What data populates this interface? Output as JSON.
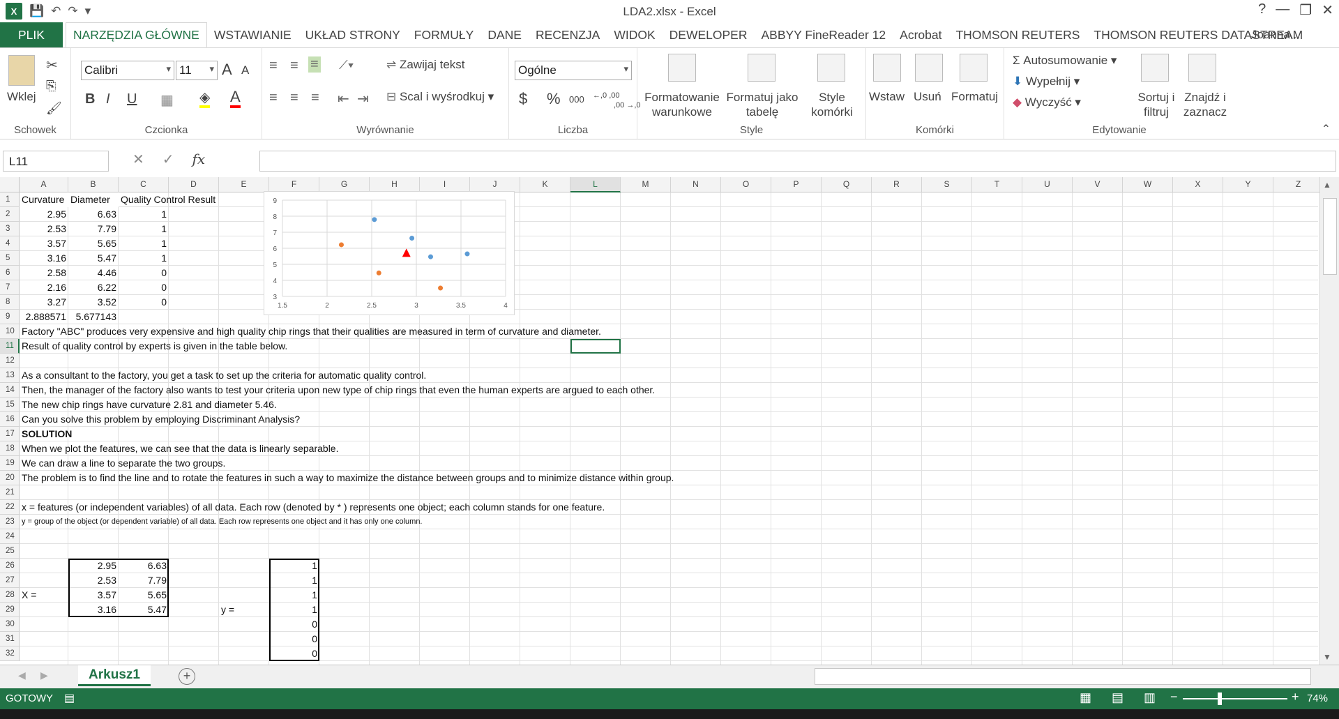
{
  "window": {
    "title": "LDA2.xlsx - Excel",
    "help": "?",
    "user": "Joanna...",
    "minimize": "—",
    "restore": "❐",
    "close": "✕"
  },
  "qat": {
    "save": "💾",
    "undo": "↶",
    "redo": "↷",
    "customize": "▾"
  },
  "tabs": [
    "PLIK",
    "NARZĘDZIA GŁÓWNE",
    "WSTAWIANIE",
    "UKŁAD STRONY",
    "FORMUŁY",
    "DANE",
    "RECENZJA",
    "WIDOK",
    "DEWELOPER",
    "ABBYY FineReader 12",
    "Acrobat",
    "THOMSON REUTERS",
    "THOMSON REUTERS DATASTREAM"
  ],
  "ribbon": {
    "clipboard": {
      "label": "Schowek",
      "paste": "Wklej"
    },
    "font": {
      "label": "Czcionka",
      "name": "Calibri",
      "size": "11",
      "bold": "B",
      "italic": "I",
      "underline": "U",
      "grow": "A",
      "shrink": "A",
      "color_letter": "A"
    },
    "alignment": {
      "label": "Wyrównanie",
      "wrap": "Zawijaj tekst",
      "merge": "Scal i wyśrodkuj"
    },
    "number": {
      "label": "Liczba",
      "format": "Ogólne",
      "currency": "$",
      "percent": "%",
      "thousands": "000",
      "inc_dec": "←,0 ,00",
      "dec_dec": ",00 →,0"
    },
    "styles": {
      "label": "Style",
      "conditional": "Formatowanie warunkowe",
      "table": "Formatuj jako tabelę",
      "cell": "Style komórki"
    },
    "cells": {
      "label": "Komórki",
      "insert": "Wstaw",
      "delete": "Usuń",
      "format": "Formatuj"
    },
    "editing": {
      "label": "Edytowanie",
      "autosum": "Autosumowanie",
      "fill": "Wypełnij",
      "clear": "Wyczyść",
      "sort": "Sortuj i filtruj",
      "find": "Znajdź i zaznacz"
    }
  },
  "formula_bar": {
    "name_box": "L11",
    "fx": "fx",
    "cancel": "✕",
    "confirm": "✓",
    "value": ""
  },
  "columns": [
    "A",
    "B",
    "C",
    "D",
    "E",
    "F",
    "G",
    "H",
    "I",
    "J",
    "K",
    "L",
    "M",
    "N",
    "O",
    "P",
    "Q",
    "R",
    "S",
    "T",
    "U",
    "V",
    "W",
    "X",
    "Y",
    "Z"
  ],
  "rows": [
    "1",
    "2",
    "3",
    "4",
    "5",
    "6",
    "7",
    "8",
    "9",
    "10",
    "11",
    "12",
    "13",
    "14",
    "15",
    "16",
    "17",
    "18",
    "19",
    "20",
    "21",
    "22",
    "23",
    "24",
    "25",
    "26",
    "27",
    "28",
    "29",
    "30",
    "31",
    "32"
  ],
  "cells": {
    "a1": "Curvature",
    "b1": "Diameter",
    "c1": "Quality Control Result",
    "data": [
      [
        "2.95",
        "6.63",
        "1"
      ],
      [
        "2.53",
        "7.79",
        "1"
      ],
      [
        "3.57",
        "5.65",
        "1"
      ],
      [
        "3.16",
        "5.47",
        "1"
      ],
      [
        "2.58",
        "4.46",
        "0"
      ],
      [
        "2.16",
        "6.22",
        "0"
      ],
      [
        "3.27",
        "3.52",
        "0"
      ]
    ],
    "a9": "2.888571",
    "b9": "5.677143",
    "text": [
      "Factory \"ABC\" produces very expensive and high quality chip rings that their qualities are measured in term of curvature and diameter.",
      "Result of quality control by experts is given in the table below.",
      "",
      "As a consultant to the factory, you get a task to set up the criteria for automatic quality control.",
      "Then, the manager of the factory also wants to test your criteria upon new type of chip rings that even the human experts are argued to each other.",
      " The new chip rings have curvature 2.81 and diameter 5.46.",
      "Can you solve this problem by employing Discriminant Analysis?",
      "SOLUTION",
      "When we plot the features, we can see that the data is linearly separable.",
      "We can draw a line to separate the two groups.",
      "The problem is to find the line and to rotate the features in such a way to maximize the distance between groups and to minimize distance within group.",
      "",
      "x = features (or independent variables) of all data. Each row (denoted by * ) represents one object; each column stands for one feature.",
      "y = group of the object (or dependent variable) of all data. Each row represents one object and it has only one column."
    ],
    "x_label": "X =",
    "y_label": "y =",
    "x_matrix": [
      [
        "2.95",
        "6.63"
      ],
      [
        "2.53",
        "7.79"
      ],
      [
        "3.57",
        "5.65"
      ],
      [
        "3.16",
        "5.47"
      ]
    ],
    "y_vector": [
      "1",
      "1",
      "1",
      "1",
      "0",
      "0",
      "0"
    ]
  },
  "chart_data": {
    "type": "scatter",
    "xlim": [
      1.5,
      4
    ],
    "ylim": [
      3,
      9
    ],
    "xticks": [
      "1.5",
      "2",
      "2.5",
      "3",
      "3.5",
      "4"
    ],
    "yticks": [
      "3",
      "4",
      "5",
      "6",
      "7",
      "8",
      "9"
    ],
    "grid": true,
    "series": [
      {
        "color": "#5b9bd5",
        "points": [
          [
            2.53,
            7.79
          ],
          [
            2.95,
            6.63
          ],
          [
            3.16,
            5.47
          ],
          [
            3.57,
            5.65
          ]
        ]
      },
      {
        "color": "#ed7d31",
        "points": [
          [
            2.16,
            6.22
          ],
          [
            2.58,
            4.46
          ],
          [
            3.27,
            3.52
          ]
        ]
      },
      {
        "color": "#ff0000",
        "marker": "triangle",
        "points": [
          [
            2.888571,
            5.677143
          ]
        ]
      }
    ]
  },
  "sheet": {
    "tab": "Arkusz1",
    "add": "+"
  },
  "status": {
    "mode": "GOTOWY",
    "zoom": "74%",
    "zoom_minus": "−",
    "zoom_plus": "+"
  }
}
